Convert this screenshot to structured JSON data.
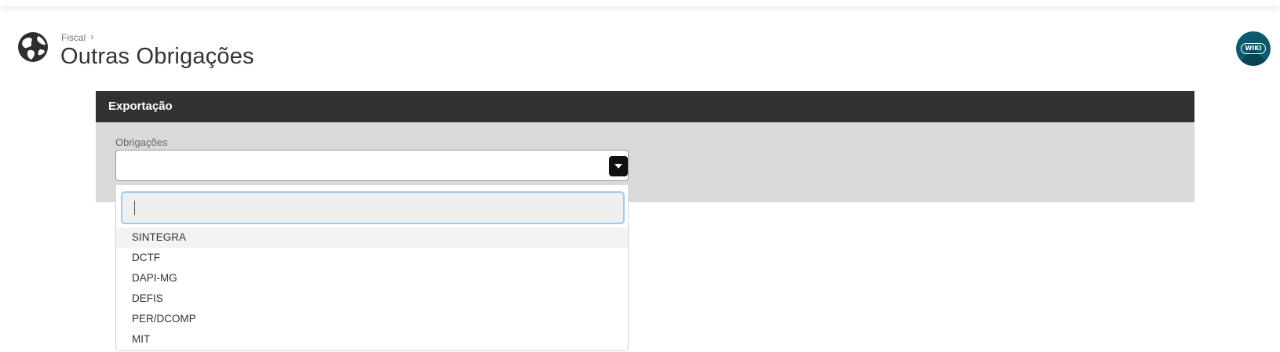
{
  "header": {
    "breadcrumb": "Fiscal",
    "breadcrumb_sep": "›",
    "title": "Outras Obrigações",
    "wiki_label": "WIKI"
  },
  "panel": {
    "title": "Exportação",
    "field_label": "Obrigações",
    "selected_value": ""
  },
  "dropdown": {
    "search_value": "",
    "options": [
      "SINTEGRA",
      "DCTF",
      "DAPI-MG",
      "DEFIS",
      "PER/DCOMP",
      "MIT"
    ],
    "highlighted_index": 0
  },
  "colors": {
    "panel_header_bg": "#323232",
    "panel_bg": "#d9d9d9",
    "wiki_bg": "#0d5a6c",
    "search_focus_border": "#9ecbec"
  },
  "icons": {
    "page_icon": "globe-icon",
    "breadcrumb_sep": "chevron-right-icon",
    "select_toggle": "caret-down-icon",
    "wiki": "wiki-icon"
  }
}
